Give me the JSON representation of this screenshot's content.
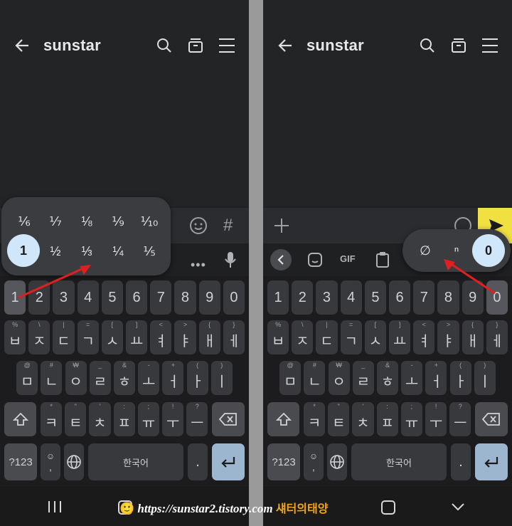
{
  "app": {
    "title": "sunstar"
  },
  "keyboard": {
    "numbers": [
      "1",
      "2",
      "3",
      "4",
      "5",
      "6",
      "7",
      "8",
      "9",
      "0"
    ],
    "row1": [
      {
        "h": "%",
        "k": "ㅂ"
      },
      {
        "h": "\\",
        "k": "ㅈ"
      },
      {
        "h": "|",
        "k": "ㄷ"
      },
      {
        "h": "=",
        "k": "ㄱ"
      },
      {
        "h": "[",
        "k": "ㅅ"
      },
      {
        "h": "]",
        "k": "ㅛ"
      },
      {
        "h": "<",
        "k": "ㅕ"
      },
      {
        "h": ">",
        "k": "ㅑ"
      },
      {
        "h": "{",
        "k": "ㅐ"
      },
      {
        "h": "}",
        "k": "ㅔ"
      }
    ],
    "row2": [
      {
        "h": "@",
        "k": "ㅁ"
      },
      {
        "h": "#",
        "k": "ㄴ"
      },
      {
        "h": "₩",
        "k": "ㅇ"
      },
      {
        "h": "_",
        "k": "ㄹ"
      },
      {
        "h": "&",
        "k": "ㅎ"
      },
      {
        "h": "-",
        "k": "ㅗ"
      },
      {
        "h": "+",
        "k": "ㅓ"
      },
      {
        "h": "(",
        "k": "ㅏ"
      },
      {
        "h": ")",
        "k": "ㅣ"
      }
    ],
    "row3": [
      {
        "h": "*",
        "k": "ㅋ"
      },
      {
        "h": "\"",
        "k": "ㅌ"
      },
      {
        "h": "'",
        "k": "ㅊ"
      },
      {
        "h": ":",
        "k": "ㅍ"
      },
      {
        "h": ";",
        "k": "ㅠ"
      },
      {
        "h": "!",
        "k": "ㅜ"
      },
      {
        "h": "?",
        "k": "ㅡ"
      }
    ],
    "sym_label": "?123",
    "space_label": "한국어",
    "period": ".",
    "comma": ","
  },
  "left_popup": {
    "row1": [
      "⅙",
      "⅐",
      "⅛",
      "⅑",
      "⅒"
    ],
    "row2": [
      "1",
      "½",
      "⅓",
      "¼",
      "⅕"
    ],
    "selected": "1"
  },
  "right_popup": {
    "items": [
      "∅",
      "ⁿ",
      "0"
    ],
    "selected": "0"
  },
  "toolbar": {
    "gif_label": "GIF"
  },
  "left_input": {
    "hash": "#"
  },
  "watermark": {
    "url": "https://sunstar2.tistory.com",
    "name": "섀터의태양"
  },
  "colors": {
    "arrow": "#e02020",
    "selected": "#cfe6fb",
    "send": "#f0e040"
  }
}
